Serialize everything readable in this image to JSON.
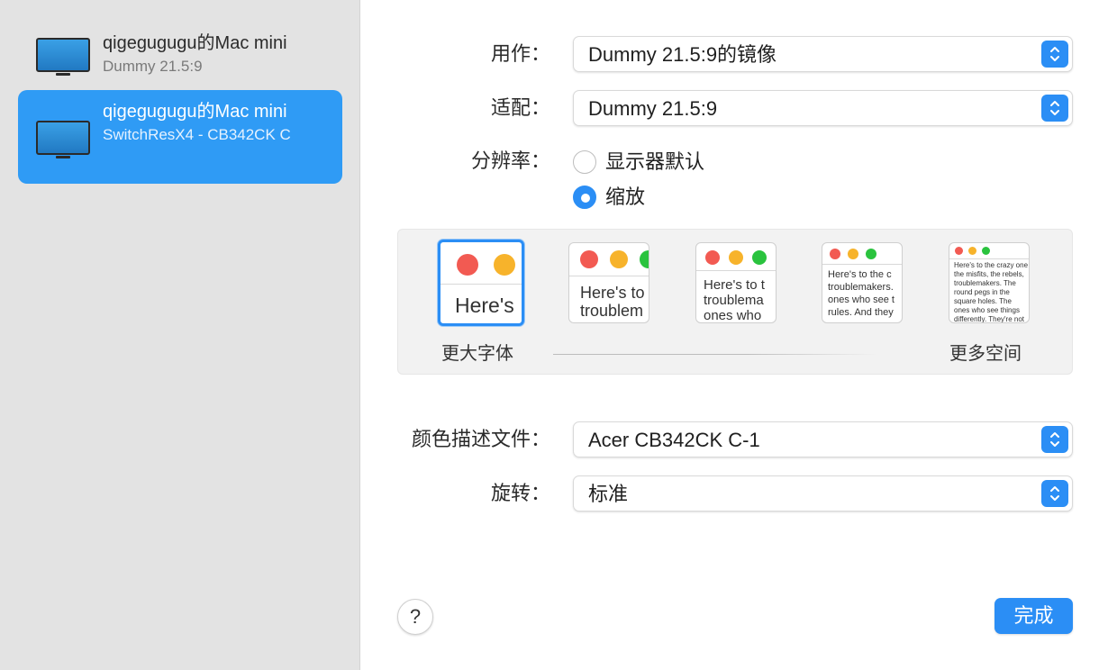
{
  "sidebar": {
    "displays": [
      {
        "name": "qigegugugu的Mac mini",
        "sub": "Dummy 21.5:9"
      },
      {
        "name": "qigegugugu的Mac mini",
        "sub": "SwitchResX4 - CB342CK C"
      }
    ]
  },
  "settings": {
    "use_as": {
      "label": "用作：",
      "value": "Dummy 21.5:9的镜像"
    },
    "optimize": {
      "label": "适配：",
      "value": "Dummy 21.5:9"
    },
    "resolution": {
      "label": "分辨率：",
      "options": [
        {
          "label": "显示器默认",
          "selected": false
        },
        {
          "label": "缩放",
          "selected": true
        }
      ]
    },
    "scale": {
      "left_caption": "更大字体",
      "right_caption": "更多空间",
      "thumbnails": [
        {
          "text": "Here's",
          "selected": true
        },
        {
          "text": "Here's to troublem",
          "selected": false
        },
        {
          "text": "Here's to t troublema ones who",
          "selected": false
        },
        {
          "text": "Here's to the c troublemakers. ones who see t rules. And they",
          "selected": false
        },
        {
          "text": "Here's to the crazy one the misfits, the rebels, troublemakers. The round pegs in the square holes. The ones who see things differently. They're not fond of rules. And they have no respect for the status quo.",
          "selected": false
        }
      ],
      "selected_index": 0
    },
    "color_profile": {
      "label": "颜色描述文件：",
      "value": "Acer CB342CK C-1"
    },
    "rotation": {
      "label": "旋转：",
      "value": "标准"
    }
  },
  "footer": {
    "help": "?",
    "done": "完成"
  },
  "colors": {
    "accent": "#2b8ef5",
    "sidebar_selected": "#2f9bf5",
    "traffic_red": "#f25a52",
    "traffic_yellow": "#f7b32b",
    "traffic_green": "#2ac33e"
  }
}
